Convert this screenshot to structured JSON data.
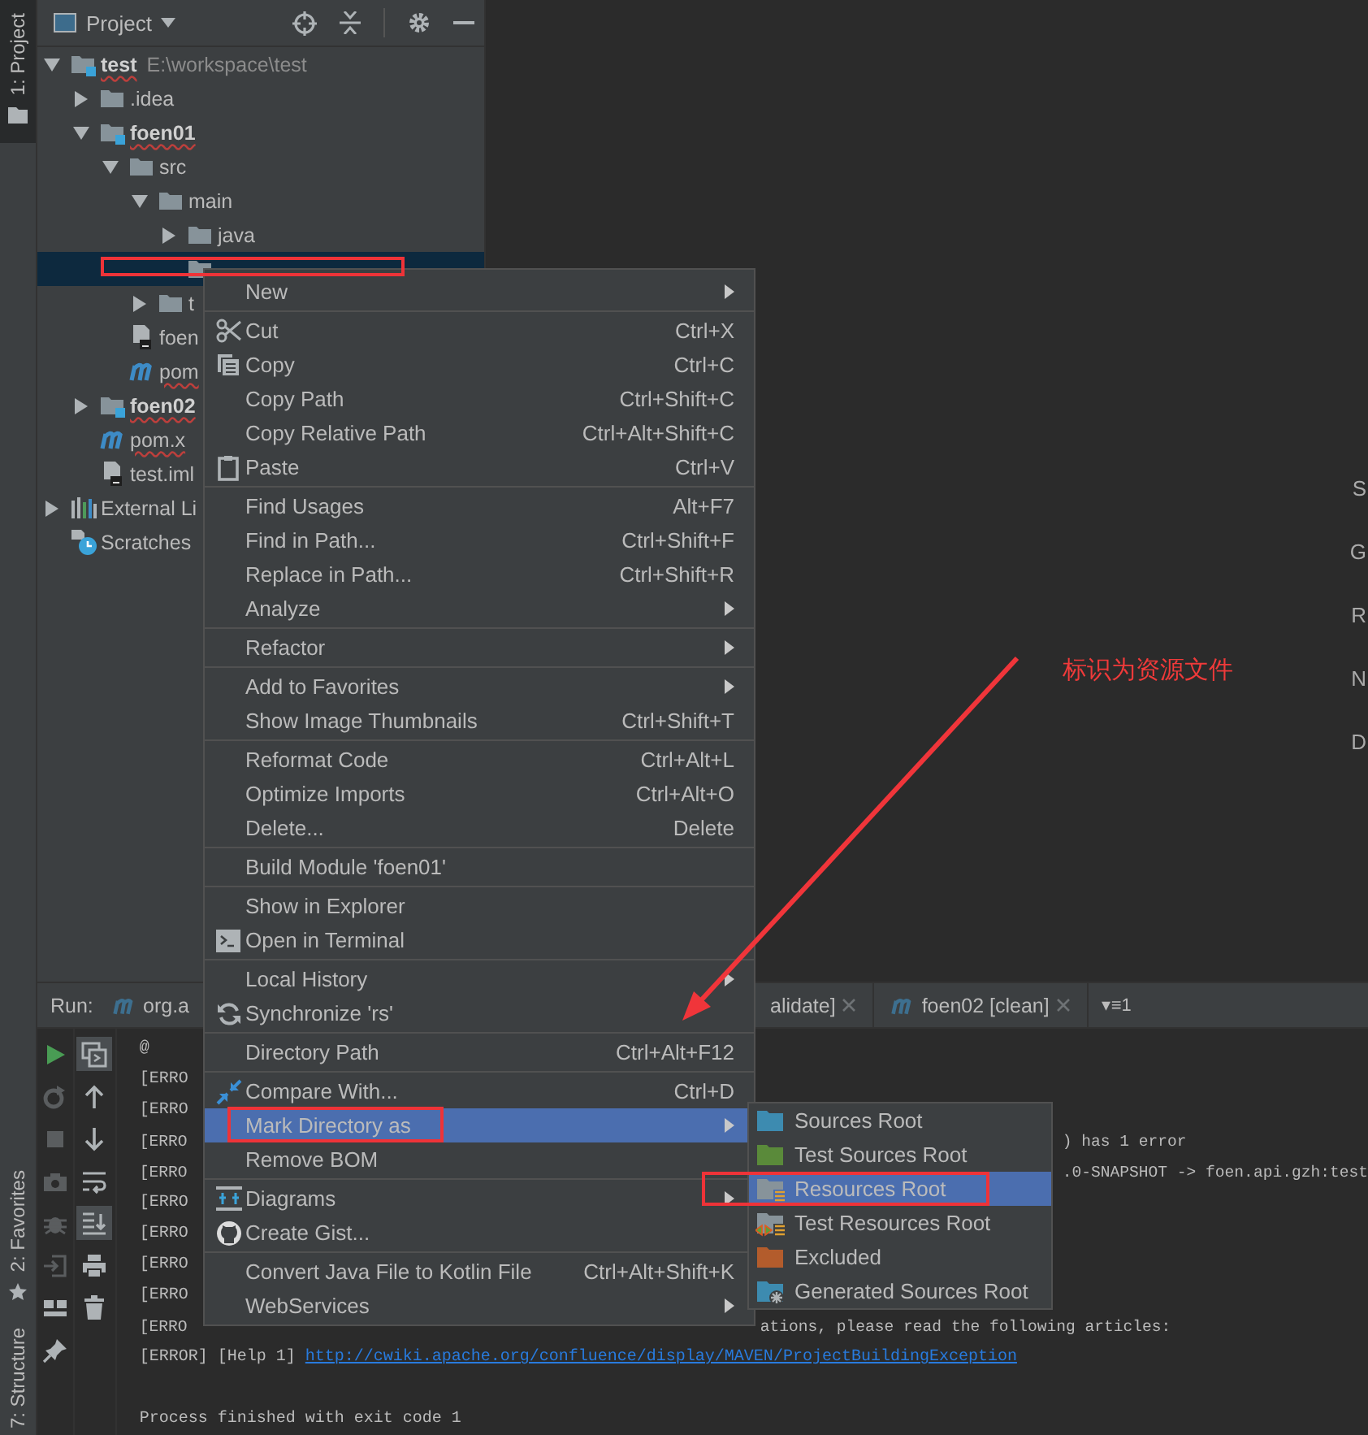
{
  "left_stripe": {
    "top": [
      {
        "label": "1: Project",
        "kind": "project",
        "selected": true
      }
    ],
    "bottom": [
      {
        "label": "2: Favorites",
        "kind": "favorites",
        "selected": false
      },
      {
        "label": "7: Structure",
        "kind": "structure",
        "selected": false
      }
    ]
  },
  "project": {
    "title": "Project",
    "tree": [
      {
        "label": "test",
        "hint": "E:\\workspace\\test",
        "kind": "module",
        "bold": true,
        "error": true,
        "expanded": true,
        "selected": false,
        "children": [
          {
            "label": ".idea",
            "kind": "folder",
            "expanded": false,
            "selected": false
          },
          {
            "label": "foen01",
            "kind": "module",
            "bold": true,
            "error": true,
            "expanded": true,
            "selected": false,
            "children": [
              {
                "label": "src",
                "kind": "folder",
                "expanded": true,
                "selected": false,
                "children": [
                  {
                    "label": "main",
                    "kind": "folder",
                    "expanded": true,
                    "selected": false,
                    "children": [
                      {
                        "label": "java",
                        "kind": "folder",
                        "expanded": false,
                        "selected": false
                      },
                      {
                        "kind": "folder",
                        "selected": true
                      }
                    ]
                  },
                  {
                    "label": "t",
                    "kind": "folder",
                    "expanded": false,
                    "selected": false
                  }
                ]
              },
              {
                "label": "foen",
                "kind": "iml",
                "selected": false
              },
              {
                "label": "pom",
                "kind": "maven",
                "error": true,
                "selected": false
              }
            ]
          },
          {
            "label": "foen02",
            "kind": "module",
            "bold": true,
            "error": true,
            "expanded": false,
            "selected": false
          },
          {
            "label": "pom.x",
            "kind": "maven",
            "error": true,
            "selected": false
          },
          {
            "label": "test.iml",
            "kind": "iml",
            "selected": false
          }
        ]
      },
      {
        "label": "External Li",
        "kind": "library",
        "expanded": false,
        "selected": false
      },
      {
        "label": "Scratches",
        "kind": "scratches",
        "selected": false
      }
    ]
  },
  "editor": {
    "hints": [
      "S",
      "G",
      "R",
      "N",
      "D"
    ]
  },
  "annotation": {
    "text": "标识为资源文件"
  },
  "run": {
    "label": "Run:",
    "tabs": [
      {
        "label": "org.a",
        "kind": "maven",
        "closable": false
      },
      {
        "label": "alidate]",
        "kind": "plain",
        "closable": true
      },
      {
        "label": "foen02 [clean]",
        "kind": "maven",
        "closable": true
      }
    ],
    "overflow": "▾≡1",
    "toolbar": [
      {
        "kind": "run",
        "enabled": true
      },
      {
        "kind": "rerun",
        "enabled": false
      },
      {
        "kind": "stop",
        "enabled": false
      },
      {
        "kind": "camera",
        "enabled": false
      },
      {
        "kind": "debug",
        "enabled": false
      },
      {
        "kind": "exit",
        "enabled": false
      },
      {
        "kind": "layout",
        "enabled": true
      },
      {
        "kind": "pin",
        "enabled": true
      }
    ],
    "toolbar2": [
      {
        "kind": "console",
        "selected": true
      },
      {
        "kind": "up",
        "selected": false
      },
      {
        "kind": "down",
        "selected": false
      },
      {
        "kind": "wrap",
        "selected": false
      },
      {
        "kind": "scroll-end",
        "selected": true
      },
      {
        "kind": "print",
        "selected": false
      },
      {
        "kind": "trash",
        "selected": false
      }
    ],
    "console": [
      {
        "prefix": "@"
      },
      {
        "prefix": "[ERRO"
      },
      {
        "prefix": "[ERRO"
      },
      {
        "prefix": "[ERRO",
        "tail": ") has 1 error"
      },
      {
        "prefix": "[ERRO",
        "tail": ".0-SNAPSHOT -> foen.api.gzh:test"
      },
      {
        "prefix": "[ERRO"
      },
      {
        "prefix": "[ERRO"
      },
      {
        "prefix": "[ERRO"
      },
      {
        "prefix": "[ERRO"
      },
      {
        "prefix": "[ERRO",
        "message": "ations, please read the following articles:"
      },
      {
        "prefix": "[ERROR] [Help 1] ",
        "link": "http://cwiki.apache.org/confluence/display/MAVEN/ProjectBuildingException"
      },
      {
        "prefix": "Process finished with exit code 1",
        "kind": "exit"
      }
    ]
  },
  "context_menu": {
    "groups": [
      [
        {
          "label": "New",
          "submenu": true,
          "selected": false
        }
      ],
      [
        {
          "label": "Cut",
          "shortcut": "Ctrl+X",
          "kind": "cut",
          "selected": false
        },
        {
          "label": "Copy",
          "shortcut": "Ctrl+C",
          "kind": "copy",
          "selected": false
        },
        {
          "label": "Copy Path",
          "shortcut": "Ctrl+Shift+C",
          "selected": false
        },
        {
          "label": "Copy Relative Path",
          "shortcut": "Ctrl+Alt+Shift+C",
          "selected": false
        },
        {
          "label": "Paste",
          "shortcut": "Ctrl+V",
          "kind": "paste",
          "selected": false
        }
      ],
      [
        {
          "label": "Find Usages",
          "shortcut": "Alt+F7",
          "selected": false
        },
        {
          "label": "Find in Path...",
          "shortcut": "Ctrl+Shift+F",
          "selected": false
        },
        {
          "label": "Replace in Path...",
          "shortcut": "Ctrl+Shift+R",
          "selected": false
        },
        {
          "label": "Analyze",
          "submenu": true,
          "selected": false
        }
      ],
      [
        {
          "label": "Refactor",
          "submenu": true,
          "selected": false
        }
      ],
      [
        {
          "label": "Add to Favorites",
          "submenu": true,
          "selected": false
        },
        {
          "label": "Show Image Thumbnails",
          "shortcut": "Ctrl+Shift+T",
          "selected": false
        }
      ],
      [
        {
          "label": "Reformat Code",
          "shortcut": "Ctrl+Alt+L",
          "selected": false
        },
        {
          "label": "Optimize Imports",
          "shortcut": "Ctrl+Alt+O",
          "selected": false
        },
        {
          "label": "Delete...",
          "shortcut": "Delete",
          "selected": false
        }
      ],
      [
        {
          "label": "Build Module 'foen01'",
          "selected": false
        }
      ],
      [
        {
          "label": "Show in Explorer",
          "selected": false
        },
        {
          "label": "Open in Terminal",
          "kind": "terminal",
          "selected": false
        }
      ],
      [
        {
          "label": "Local History",
          "submenu": true,
          "selected": false
        },
        {
          "label": "Synchronize 'rs'",
          "kind": "sync",
          "selected": false
        }
      ],
      [
        {
          "label": "Directory Path",
          "shortcut": "Ctrl+Alt+F12",
          "selected": false
        }
      ],
      [
        {
          "label": "Compare With...",
          "shortcut": "Ctrl+D",
          "kind": "compare",
          "selected": false
        },
        {
          "label": "Mark Directory as",
          "submenu": true,
          "selected": true
        },
        {
          "label": "Remove BOM",
          "selected": false
        }
      ],
      [
        {
          "label": "Diagrams",
          "submenu": true,
          "kind": "diagram",
          "selected": false
        },
        {
          "label": "Create Gist...",
          "kind": "gist",
          "selected": false
        }
      ],
      [
        {
          "label": "Convert Java File to Kotlin File",
          "shortcut": "Ctrl+Alt+Shift+K",
          "selected": false
        },
        {
          "label": "WebServices",
          "submenu": true,
          "selected": false
        }
      ]
    ]
  },
  "submenu": {
    "items": [
      {
        "label": "Sources Root",
        "kind": "sources",
        "selected": false
      },
      {
        "label": "Test Sources Root",
        "kind": "test-sources",
        "selected": false
      },
      {
        "label": "Resources Root",
        "kind": "resources",
        "selected": true
      },
      {
        "label": "Test Resources Root",
        "kind": "test-resources",
        "selected": false
      },
      {
        "label": "Excluded",
        "kind": "excluded",
        "selected": false
      },
      {
        "label": "Generated Sources Root",
        "kind": "generated",
        "selected": false
      }
    ]
  }
}
